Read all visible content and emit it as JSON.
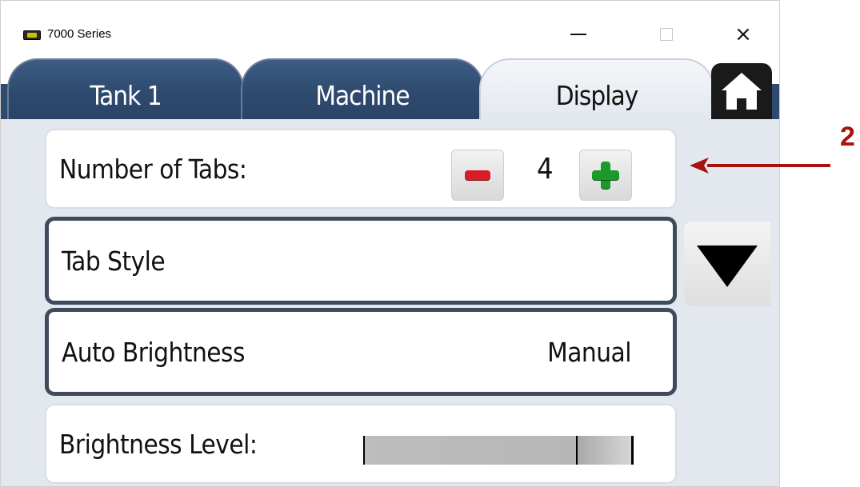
{
  "window": {
    "title": "7000 Series",
    "icon": "app-chip-icon",
    "controls": {
      "minimize": "minimize-icon",
      "maximize": "maximize-icon",
      "close": "×"
    }
  },
  "tabs": [
    {
      "label": "Tank 1",
      "active": false
    },
    {
      "label": "Machine",
      "active": false
    },
    {
      "label": "Display",
      "active": true
    }
  ],
  "home_icon": "home-icon",
  "settings": {
    "number_of_tabs": {
      "label": "Number of Tabs:",
      "value": "4"
    },
    "tab_style": {
      "label": "Tab Style"
    },
    "auto_brightness": {
      "label": "Auto Brightness",
      "value": "Manual"
    },
    "brightness_level": {
      "label": "Brightness Level:",
      "level_fraction": 0.8
    }
  },
  "scroll_down_icon": "triangle-down-icon",
  "annotation": {
    "number": "2"
  },
  "colors": {
    "tab_blue": "#2e4a6e",
    "panel_bg": "#e3e8ef",
    "minus_red": "#d71d27",
    "plus_green": "#1b9a2c",
    "callout_red": "#a8120f"
  }
}
